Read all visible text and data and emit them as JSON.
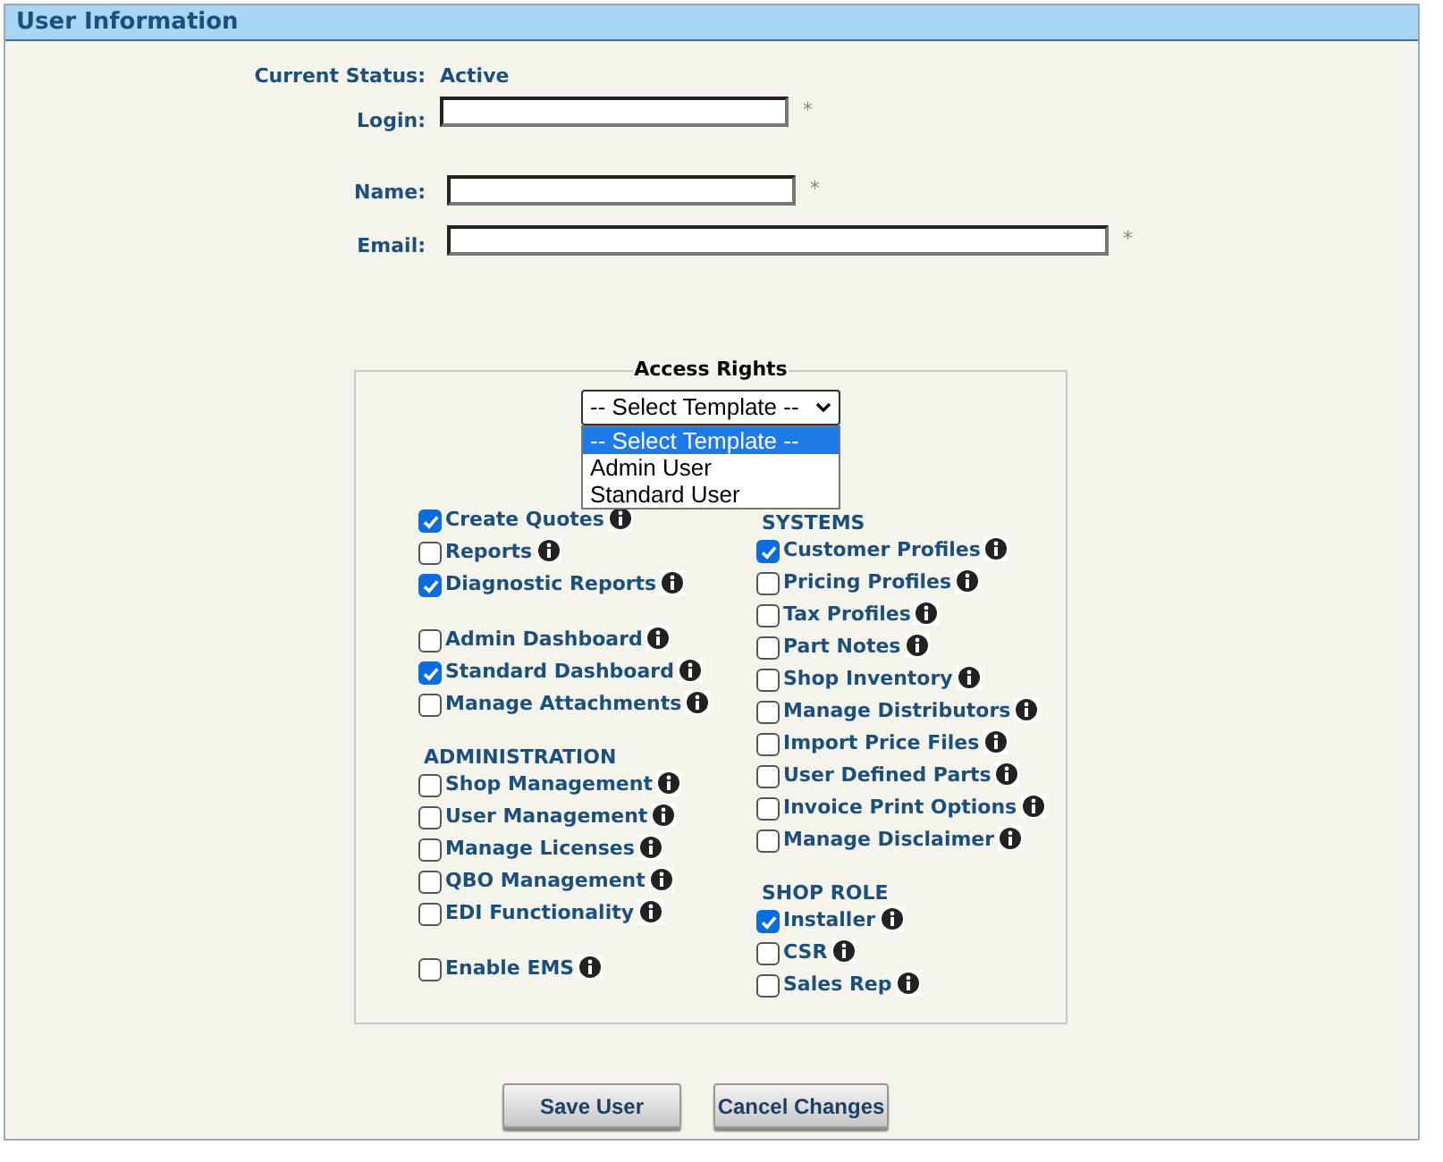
{
  "panel": {
    "title": "User Information"
  },
  "status": {
    "label": "Current Status:",
    "value": "Active"
  },
  "fields": [
    {
      "label": "Login:",
      "required_mark": "*"
    },
    {
      "label": "Name:",
      "required_mark": "*"
    },
    {
      "label": "Email:",
      "required_mark": "*"
    }
  ],
  "access_rights": {
    "legend": "Access Rights",
    "template_select": {
      "value": "-- Select Template --",
      "expanded": true,
      "options": [
        {
          "label": "-- Select Template --",
          "selected": true
        },
        {
          "label": "Admin User",
          "selected": false
        },
        {
          "label": "Standard User",
          "selected": false
        }
      ]
    },
    "columns": [
      {
        "groups": [
          {
            "items": [
              {
                "label": "Create Quotes",
                "checked": true
              },
              {
                "label": "Reports",
                "checked": false
              },
              {
                "label": "Diagnostic Reports",
                "checked": true
              }
            ]
          },
          {
            "items": [
              {
                "label": "Admin Dashboard",
                "checked": false
              },
              {
                "label": "Standard Dashboard",
                "checked": true
              },
              {
                "label": "Manage Attachments",
                "checked": false
              }
            ]
          },
          {
            "heading": "ADMINISTRATION",
            "items": [
              {
                "label": "Shop Management",
                "checked": false
              },
              {
                "label": "User Management",
                "checked": false
              },
              {
                "label": "Manage Licenses",
                "checked": false
              },
              {
                "label": "QBO Management",
                "checked": false
              },
              {
                "label": "EDI Functionality",
                "checked": false
              }
            ]
          },
          {
            "items": [
              {
                "label": "Enable EMS",
                "checked": false
              }
            ]
          }
        ]
      },
      {
        "groups": [
          {
            "heading": "SYSTEMS",
            "items": [
              {
                "label": "Customer Profiles",
                "checked": true
              },
              {
                "label": "Pricing Profiles",
                "checked": false
              },
              {
                "label": "Tax Profiles",
                "checked": false
              },
              {
                "label": "Part Notes",
                "checked": false
              },
              {
                "label": "Shop Inventory",
                "checked": false
              },
              {
                "label": "Manage Distributors",
                "checked": false
              },
              {
                "label": "Import Price Files",
                "checked": false
              },
              {
                "label": "User Defined Parts",
                "checked": false
              },
              {
                "label": "Invoice Print Options",
                "checked": false
              },
              {
                "label": "Manage Disclaimer",
                "checked": false
              }
            ]
          },
          {
            "heading": "SHOP ROLE",
            "items": [
              {
                "label": "Installer",
                "checked": true
              },
              {
                "label": "CSR",
                "checked": false
              },
              {
                "label": "Sales Rep",
                "checked": false
              }
            ]
          }
        ]
      }
    ]
  },
  "buttons": [
    "Save User",
    "Cancel Changes"
  ]
}
